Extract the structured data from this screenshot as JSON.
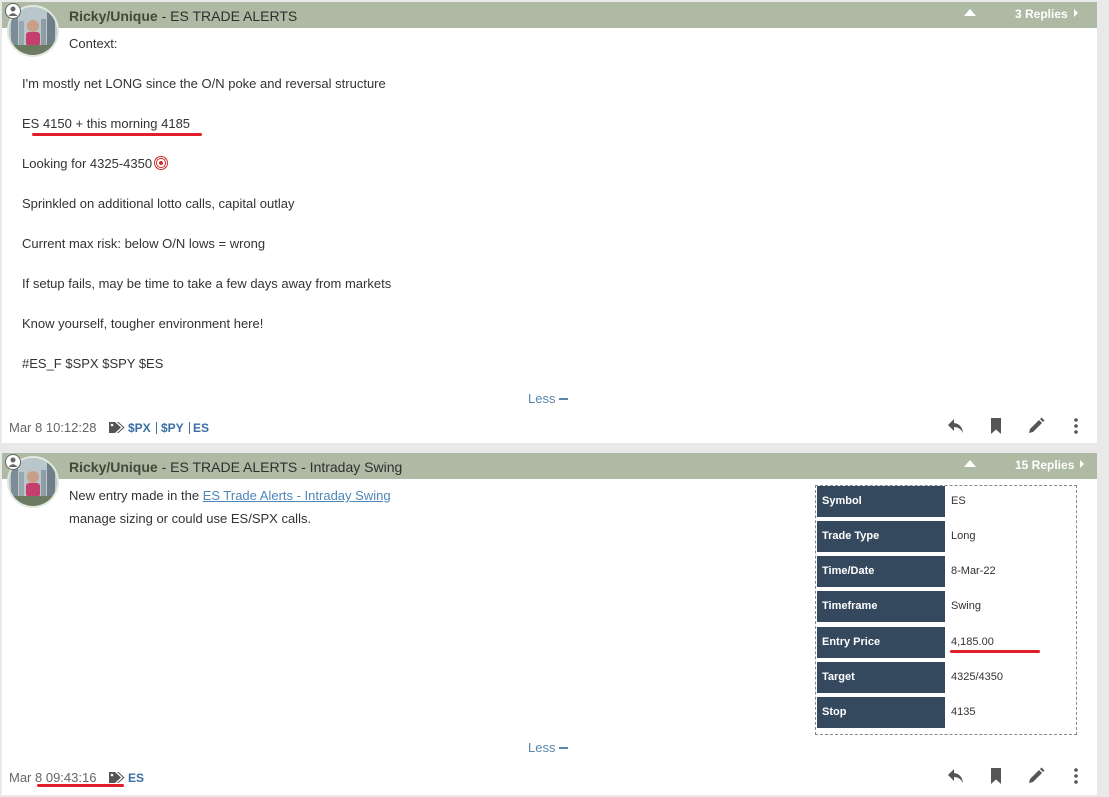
{
  "post1": {
    "author": "Ricky/Unique",
    "title": " - ES TRADE ALERTS",
    "replies": "3 Replies",
    "lines": [
      "Context:",
      "I'm mostly net LONG since the O/N poke and reversal structure",
      "ES 4150 + this morning 4185",
      "Looking for 4325-4350",
      "Sprinkled on additional lotto calls, capital outlay",
      "Current max risk: below O/N lows = wrong",
      "If setup fails, may be time to take a few days away from markets",
      "Know yourself, tougher environment here!",
      "#ES_F $SPX $SPY $ES"
    ],
    "less": "Less",
    "timestamp": "Mar 8 10:12:28",
    "tags": [
      "$PX",
      "$PY",
      "ES"
    ]
  },
  "post2": {
    "author": "Ricky/Unique",
    "title": " - ES TRADE ALERTS - Intraday Swing",
    "replies": "15 Replies",
    "line1_prefix": "New entry made in the ",
    "line1_link": "ES Trade Alerts - Intraday Swing",
    "line2": "manage sizing or could use ES/SPX calls.",
    "trade": [
      {
        "label": "Symbol",
        "value": "ES"
      },
      {
        "label": "Trade Type",
        "value": "Long"
      },
      {
        "label": "Time/Date",
        "value": "8-Mar-22"
      },
      {
        "label": "Timeframe",
        "value": "Swing"
      },
      {
        "label": "Entry Price",
        "value": "4,185.00"
      },
      {
        "label": "Target",
        "value": "4325/4350"
      },
      {
        "label": "Stop",
        "value": "4135"
      }
    ],
    "less": "Less",
    "timestamp": "Mar 8 09:43:16",
    "tags": [
      "ES"
    ]
  },
  "icons": [
    "user-icon",
    "caret-up-icon",
    "chevron-right-icon",
    "target-emoji-icon",
    "tag-icon",
    "reply-icon",
    "bookmark-icon",
    "edit-icon",
    "more-icon"
  ],
  "colors": {
    "header": "#aebaa3",
    "table_label": "#34495e",
    "link": "#4f86b7",
    "tag": "#3a6ea5",
    "highlight": "#e21e2a"
  }
}
